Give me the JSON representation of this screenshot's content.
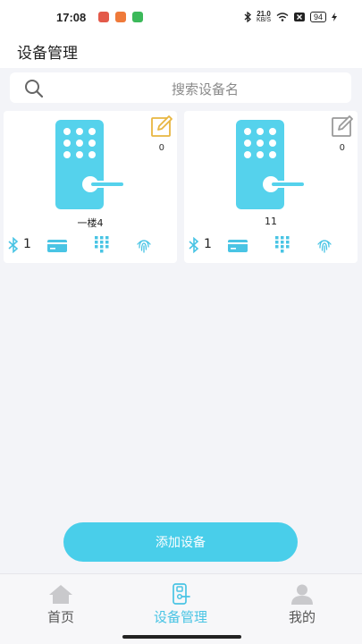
{
  "status_bar": {
    "time": "17:08",
    "net_speed_value": "21.0",
    "net_speed_unit": "KB/S",
    "battery": "94"
  },
  "header": {
    "title": "设备管理"
  },
  "search": {
    "placeholder": "搜索设备名"
  },
  "devices": [
    {
      "name": "一楼4",
      "count": "0",
      "bluetooth_count": "1",
      "edit_icon_color": "#e8b640"
    },
    {
      "name": "11",
      "count": "0",
      "bluetooth_count": "1",
      "edit_icon_color": "#9a9a9a"
    }
  ],
  "add_button_label": "添加设备",
  "tabs": [
    {
      "label": "首页",
      "icon": "home-icon",
      "active": false
    },
    {
      "label": "设备管理",
      "icon": "device-icon",
      "active": true
    },
    {
      "label": "我的",
      "icon": "person-icon",
      "active": false
    }
  ],
  "colors": {
    "accent": "#49ceea",
    "lock_body": "#55d2ec",
    "active_tab": "#49c4e4"
  }
}
